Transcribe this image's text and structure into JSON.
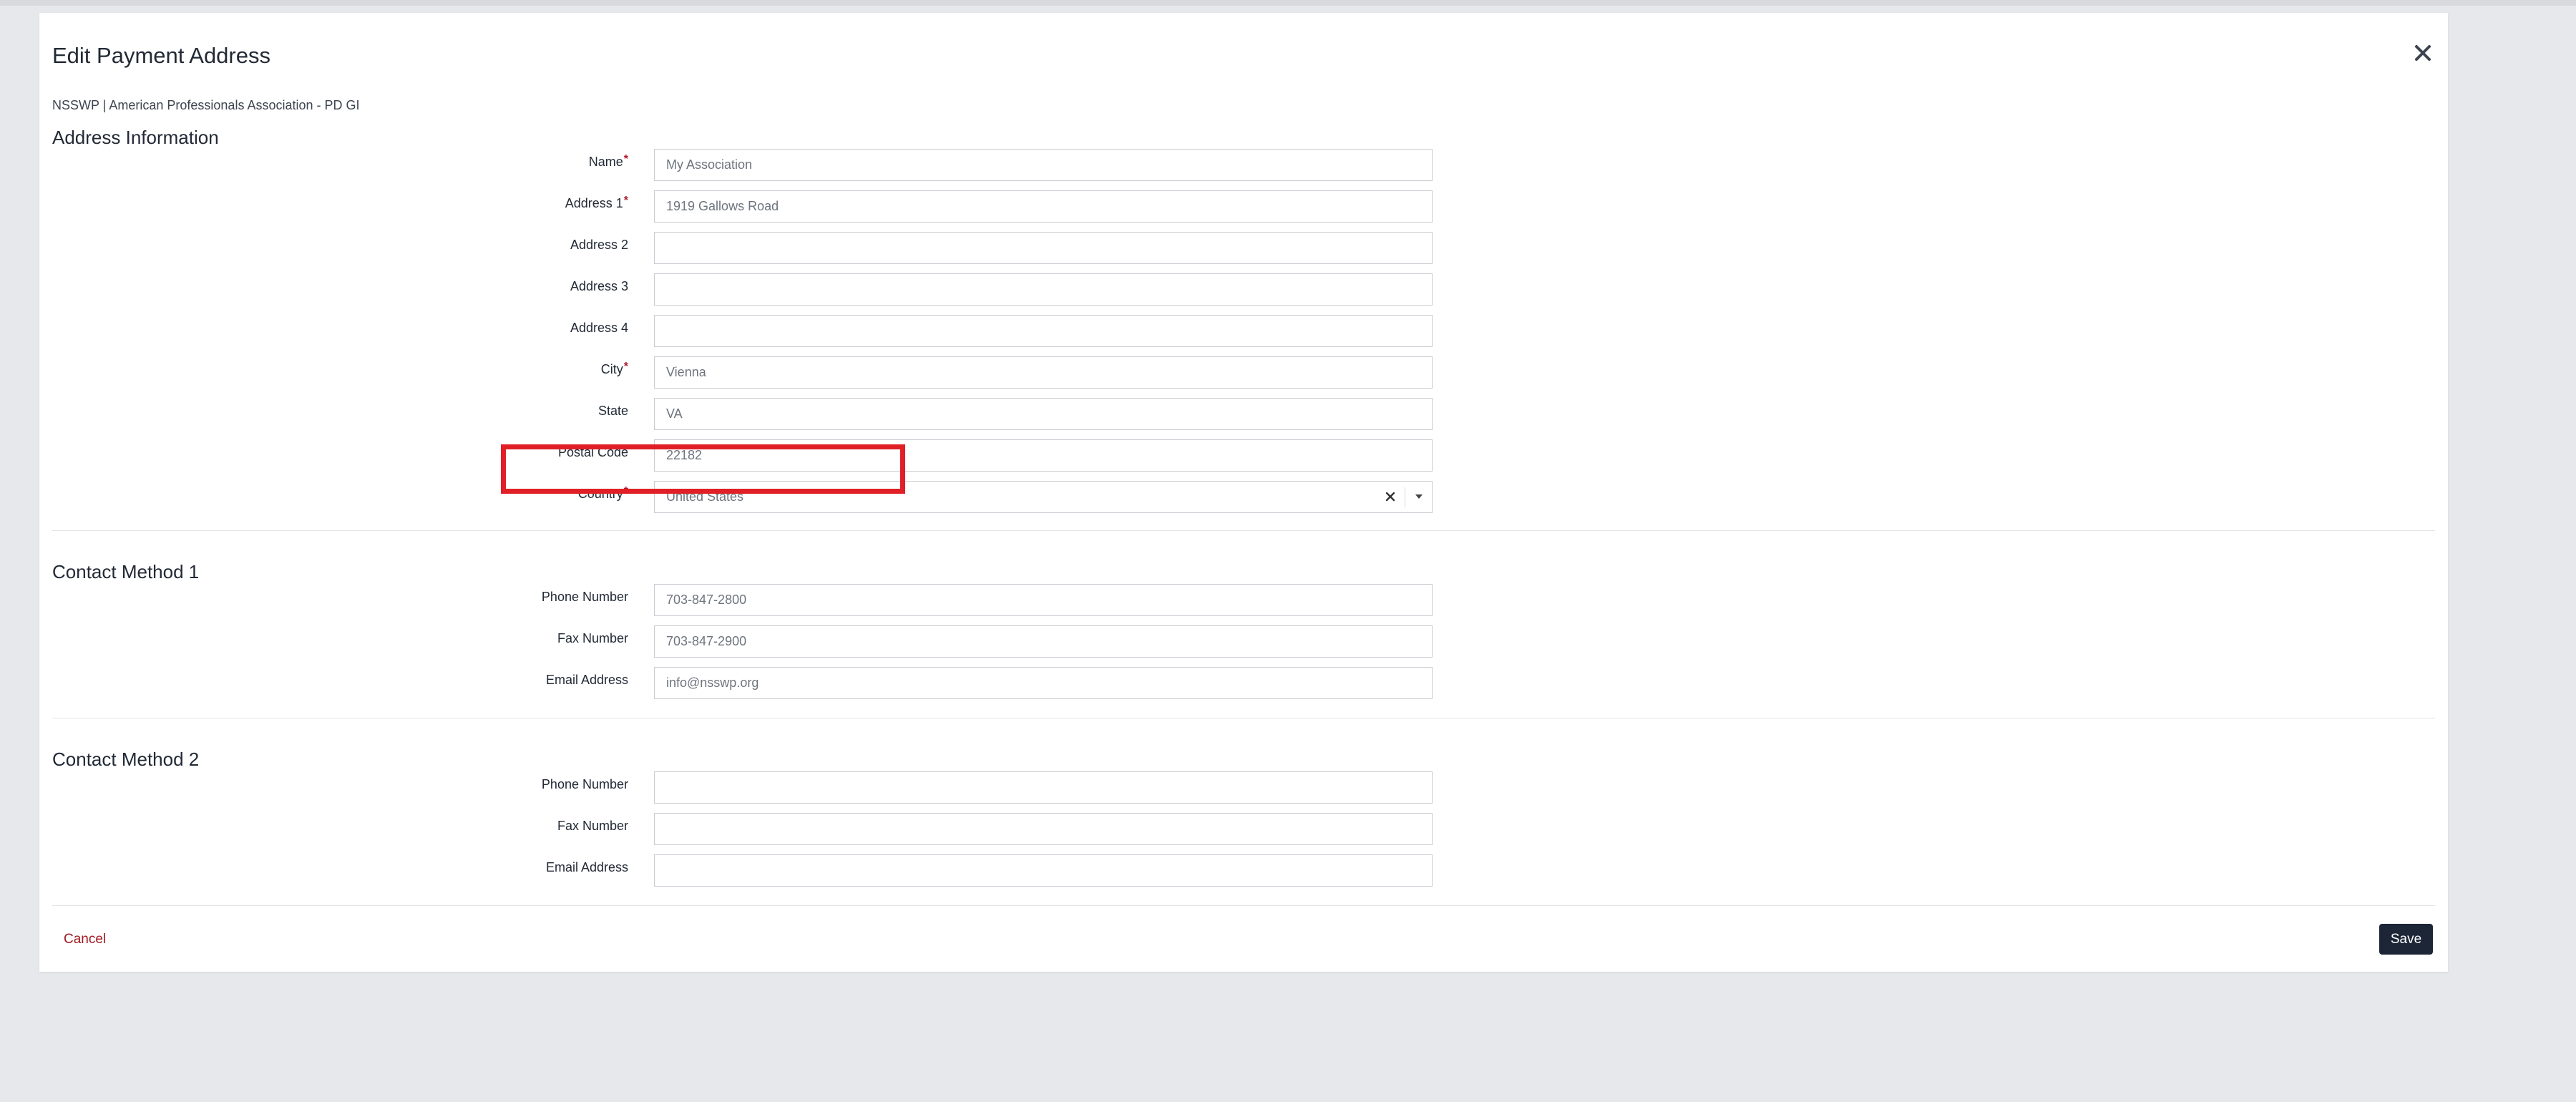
{
  "modal": {
    "title": "Edit Payment Address",
    "subtitle": "NSSWP | American Professionals Association - PD GI"
  },
  "address": {
    "section_title": "Address Information",
    "name": {
      "label": "Name",
      "value": "My Association",
      "required": true
    },
    "address1": {
      "label": "Address 1",
      "value": "1919 Gallows Road",
      "required": true
    },
    "address2": {
      "label": "Address 2",
      "value": ""
    },
    "address3": {
      "label": "Address 3",
      "value": ""
    },
    "address4": {
      "label": "Address 4",
      "value": ""
    },
    "city": {
      "label": "City",
      "value": "Vienna",
      "required": true
    },
    "state": {
      "label": "State",
      "value": "VA"
    },
    "postal": {
      "label": "Postal Code",
      "value": "22182"
    },
    "country": {
      "label": "Country",
      "value": "United States",
      "required": true
    }
  },
  "contact1": {
    "section_title": "Contact Method 1",
    "phone": {
      "label": "Phone Number",
      "value": "703-847-2800"
    },
    "fax": {
      "label": "Fax Number",
      "value": "703-847-2900"
    },
    "email": {
      "label": "Email Address",
      "value": "info@nsswp.org"
    }
  },
  "contact2": {
    "section_title": "Contact Method 2",
    "phone": {
      "label": "Phone Number",
      "value": ""
    },
    "fax": {
      "label": "Fax Number",
      "value": ""
    },
    "email": {
      "label": "Email Address",
      "value": ""
    }
  },
  "footer": {
    "cancel_label": "Cancel",
    "save_label": "Save"
  },
  "icons": {
    "close": "close-icon",
    "clear": "clear-icon",
    "dropdown": "chevron-down-icon"
  },
  "colors": {
    "required_marker": "#b0182a",
    "save_button": "#1d2637",
    "cancel_link": "#a01820",
    "highlight_box": "#e01f26"
  }
}
